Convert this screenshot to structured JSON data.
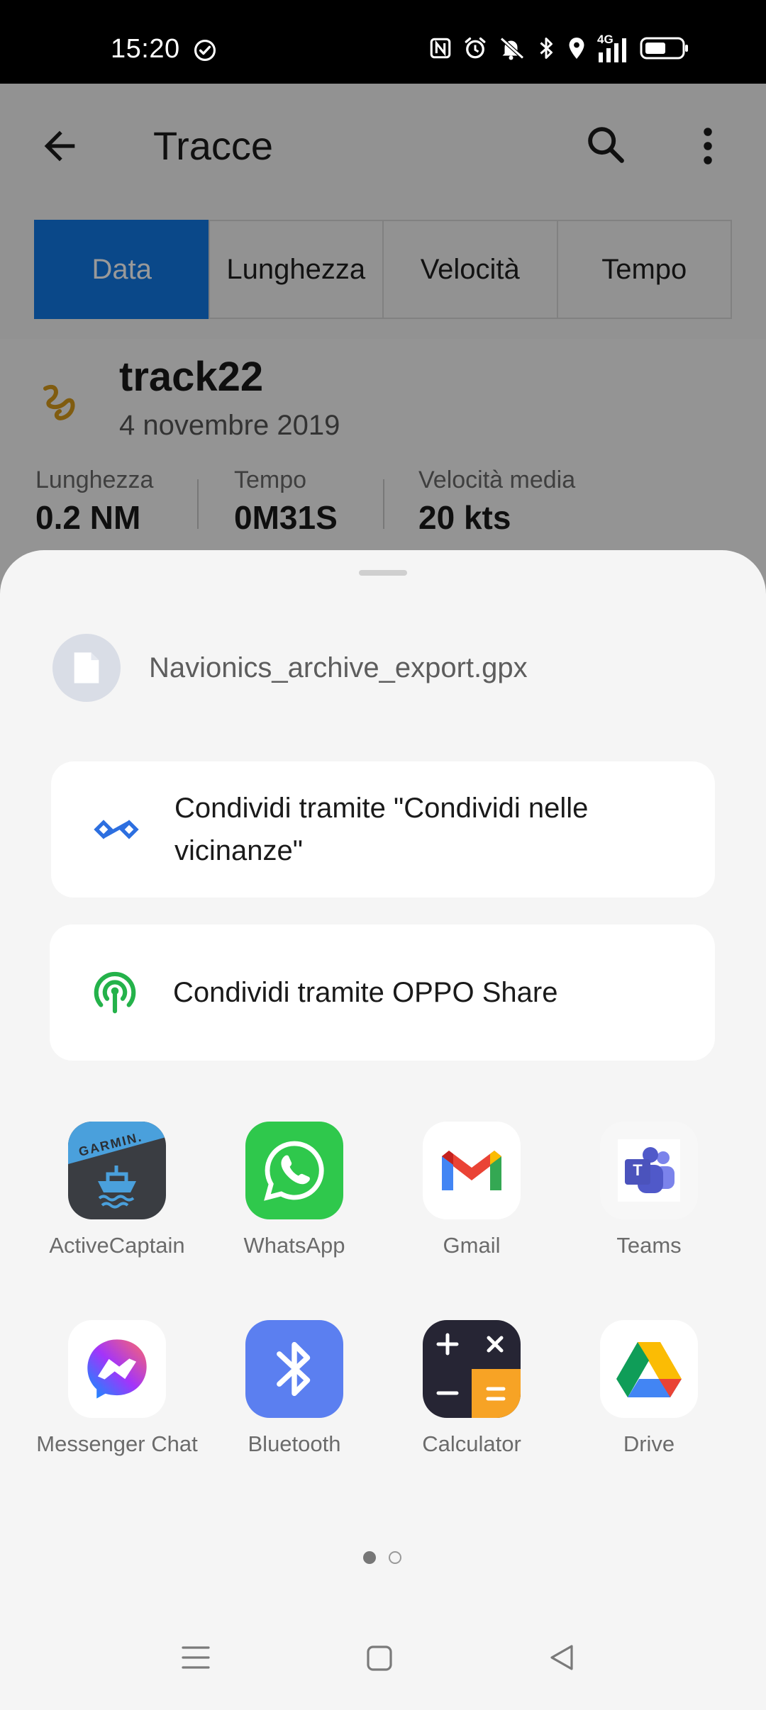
{
  "status_bar": {
    "time": "15:20",
    "network": "4G",
    "icons": [
      "check-circle-icon",
      "nfc-icon",
      "alarm-icon",
      "mute-icon",
      "bluetooth-icon",
      "location-icon",
      "signal-icon",
      "battery-icon"
    ]
  },
  "appbar": {
    "title": "Tracce",
    "tabs": [
      {
        "label": "Data",
        "active": true
      },
      {
        "label": "Lunghezza",
        "active": false
      },
      {
        "label": "Velocità",
        "active": false
      },
      {
        "label": "Tempo",
        "active": false
      }
    ]
  },
  "track": {
    "name": "track22",
    "date": "4 novembre 2019",
    "stats": [
      {
        "label": "Lunghezza",
        "value": "0.2 NM"
      },
      {
        "label": "Tempo",
        "value": "0M31S"
      },
      {
        "label": "Velocità media",
        "value": "20 kts"
      }
    ]
  },
  "share_sheet": {
    "file_name": "Navionics_archive_export.gpx",
    "nearby_share_label": "Condividi tramite \"Condividi nelle vicinanze\"",
    "oppo_share_label": "Condividi tramite OPPO Share",
    "apps": [
      {
        "label": "ActiveCaptain",
        "icon": "activecaptain-icon",
        "brand_text": "GARMIN."
      },
      {
        "label": "WhatsApp",
        "icon": "whatsapp-icon"
      },
      {
        "label": "Gmail",
        "icon": "gmail-icon"
      },
      {
        "label": "Teams",
        "icon": "teams-icon",
        "brand_text": "T"
      },
      {
        "label": "Messenger Chat",
        "icon": "messenger-icon"
      },
      {
        "label": "Bluetooth",
        "icon": "bluetooth-icon"
      },
      {
        "label": "Calculator",
        "icon": "calculator-icon"
      },
      {
        "label": "Drive",
        "icon": "drive-icon"
      }
    ],
    "page_indicator": {
      "current": 1,
      "total": 2
    }
  },
  "colors": {
    "accent": "#1278e5",
    "whatsapp": "#2fc84c",
    "bluetooth": "#5b7ff0",
    "oppo_share": "#24b24a",
    "nearby": "#2d6fe0",
    "track_icon": "#d69a1c"
  }
}
